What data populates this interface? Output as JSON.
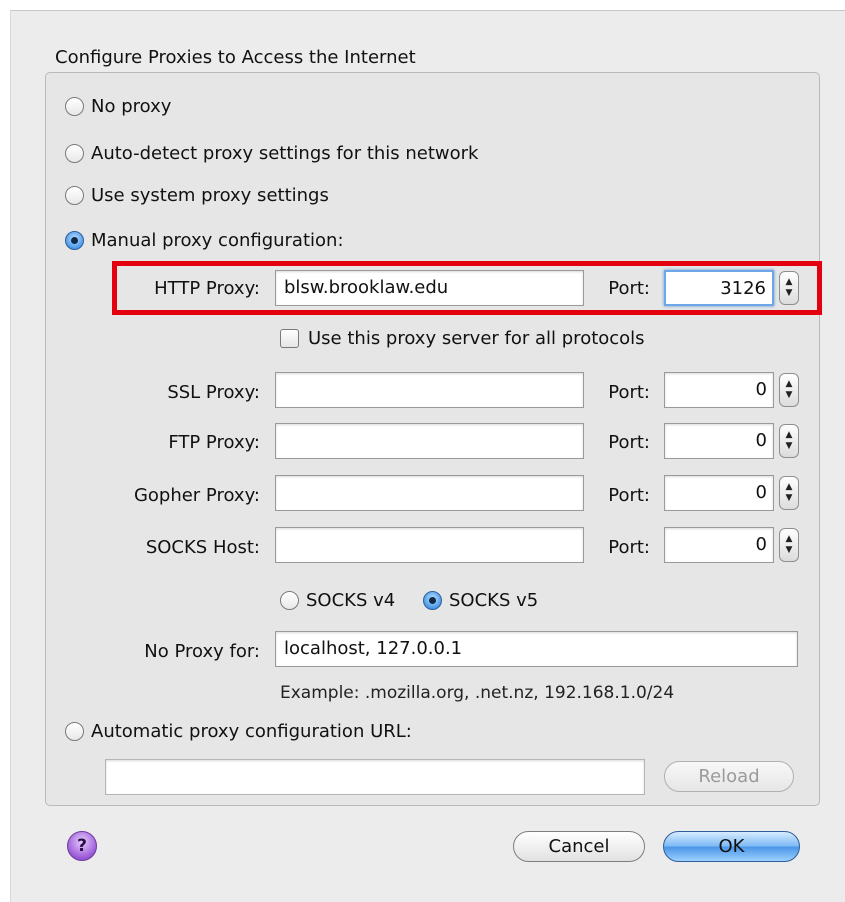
{
  "group_title": "Configure Proxies to Access the Internet",
  "options": {
    "no_proxy": "No proxy",
    "auto_detect": "Auto-detect proxy settings for this network",
    "system": "Use system proxy settings",
    "manual": "Manual proxy configuration:",
    "auto_url": "Automatic proxy configuration URL:"
  },
  "selected_option": "manual",
  "http": {
    "label": "HTTP Proxy:",
    "value": "blsw.brooklaw.edu",
    "port_label": "Port:",
    "port": "3126"
  },
  "use_all": {
    "label": "Use this proxy server for all protocols",
    "checked": false
  },
  "ssl": {
    "label": "SSL Proxy:",
    "value": "",
    "port_label": "Port:",
    "port": "0"
  },
  "ftp": {
    "label": "FTP Proxy:",
    "value": "",
    "port_label": "Port:",
    "port": "0"
  },
  "gopher": {
    "label": "Gopher Proxy:",
    "value": "",
    "port_label": "Port:",
    "port": "0"
  },
  "socks": {
    "label": "SOCKS Host:",
    "value": "",
    "port_label": "Port:",
    "port": "0"
  },
  "socks_version": {
    "v4": "SOCKS v4",
    "v5": "SOCKS v5",
    "selected": "v5"
  },
  "no_proxy_for": {
    "label": "No Proxy for:",
    "value": "localhost, 127.0.0.1",
    "example": "Example: .mozilla.org, .net.nz, 192.168.1.0/24"
  },
  "auto_url_value": "",
  "buttons": {
    "reload": "Reload",
    "cancel": "Cancel",
    "ok": "OK",
    "help": "?"
  },
  "colors": {
    "highlight": "#e3000f",
    "accent": "#4a95e6"
  }
}
